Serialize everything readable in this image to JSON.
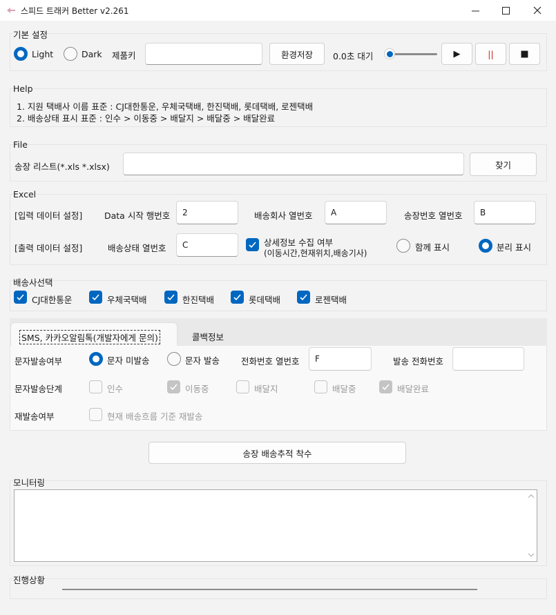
{
  "window": {
    "title": "스피드 트래커 Better v2.261",
    "min": "—",
    "max": "☐",
    "close": "✕"
  },
  "basic": {
    "group_label": "기본 설정",
    "light_label": "Light",
    "dark_label": "Dark",
    "product_key_label": "제품키",
    "product_key_value": "",
    "save_env_label": "환경저장",
    "wait_text": "0.0초 대기",
    "slider_value": 0,
    "play_label": "▶",
    "pause_label": "||",
    "stop_label": "■"
  },
  "help": {
    "group_label": "Help",
    "line1": "1. 지원 택배사 이름 표준 : CJ대한통운, 우체국택배, 한진택배, 롯데택배, 로젠택배",
    "line2": "2. 배송상태 표시 표준 : 인수 > 이동중 > 배달지 > 배달중 > 배달완료"
  },
  "file": {
    "group_label": "File",
    "invoice_list_label": "송장 리스트(*.xls *.xlsx)",
    "path_value": "",
    "find_label": "찾기"
  },
  "excel": {
    "group_label": "Excel",
    "input_setting_label": "[입력 데이터 설정]",
    "data_start_row_label": "Data 시작 행번호",
    "data_start_row_value": "2",
    "courier_col_label": "배송회사 열번호",
    "courier_col_value": "A",
    "invoice_col_label": "송장번호 열번호",
    "invoice_col_value": "B",
    "output_setting_label": "[출력 데이터 설정]",
    "status_col_label": "배송상태 열번호",
    "status_col_value": "C",
    "detail_collect_label": "상세정보 수집 여부",
    "detail_collect_sub": "(이동시간,현재위치,배송기사)",
    "show_together_label": "함께 표시",
    "show_separate_label": "분리 표시"
  },
  "couriers": {
    "group_label": "배송사선택",
    "items": [
      "CJ대한통운",
      "우체국택배",
      "한진택배",
      "롯데택배",
      "로젠택배"
    ]
  },
  "tabs": {
    "sms_tab": "SMS, 카카오알림톡(개발자에게 문의)",
    "callback_tab": "콜백정보"
  },
  "sms": {
    "send_flag_label": "문자발송여부",
    "not_send_label": "문자 미발송",
    "send_label": "문자 발송",
    "phone_col_label": "전화번호 열번호",
    "phone_col_value": "F",
    "sender_phone_label": "발송 전화번호",
    "sender_phone_value": "",
    "stage_label": "문자발송단계",
    "stages": [
      "인수",
      "이동중",
      "배달지",
      "배달중",
      "배달완료"
    ],
    "resend_label": "재발송여부",
    "resend_option": "현재 배송흐름 기준 재발송"
  },
  "start_button_label": "송장 배송추적 착수",
  "monitoring": {
    "group_label": "모니터링",
    "log_text": ""
  },
  "progress": {
    "group_label": "진행상황",
    "value": 0
  }
}
